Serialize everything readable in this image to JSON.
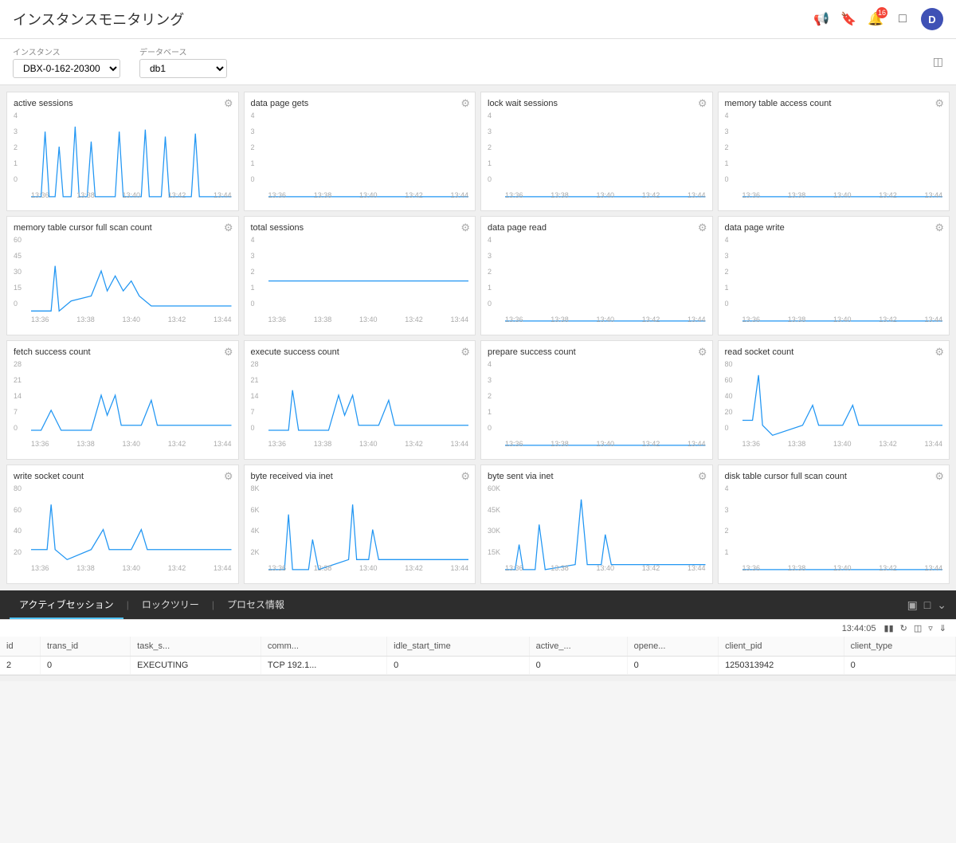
{
  "header": {
    "title": "インスタンスモニタリング",
    "icons": [
      "megaphone",
      "tag",
      "bell",
      "grid",
      "user"
    ],
    "bell_badge": "16",
    "user_initial": "D"
  },
  "toolbar": {
    "instance_label": "インスタンス",
    "instance_value": "DBX-0-162-20300",
    "database_label": "データベース",
    "database_value": "db1"
  },
  "charts": [
    {
      "id": "active-sessions",
      "title": "active sessions",
      "y_labels": [
        "4",
        "3",
        "2",
        "1",
        "0"
      ],
      "x_labels": [
        "13:36",
        "13:38",
        "13:40",
        "13:42",
        "13:44"
      ],
      "has_spikes": true,
      "spike_type": "active"
    },
    {
      "id": "data-page-gets",
      "title": "data page gets",
      "y_labels": [
        "4",
        "3",
        "2",
        "1",
        "0"
      ],
      "x_labels": [
        "13:36",
        "13:38",
        "13:40",
        "13:42",
        "13:44"
      ],
      "has_spikes": false,
      "spike_type": "flat"
    },
    {
      "id": "lock-wait-sessions",
      "title": "lock wait sessions",
      "y_labels": [
        "4",
        "3",
        "2",
        "1",
        "0"
      ],
      "x_labels": [
        "13:36",
        "13:38",
        "13:40",
        "13:42",
        "13:44"
      ],
      "has_spikes": false,
      "spike_type": "flat"
    },
    {
      "id": "memory-table-access-count",
      "title": "memory table access count",
      "y_labels": [
        "4",
        "3",
        "2",
        "1",
        "0"
      ],
      "x_labels": [
        "13:36",
        "13:38",
        "13:40",
        "13:42",
        "13:44"
      ],
      "has_spikes": false,
      "spike_type": "flat"
    },
    {
      "id": "memory-table-cursor-full-scan-count",
      "title": "memory table cursor full scan count",
      "y_labels": [
        "60",
        "45",
        "30",
        "15",
        "0"
      ],
      "x_labels": [
        "13:36",
        "13:38",
        "13:40",
        "13:42",
        "13:44"
      ],
      "has_spikes": true,
      "spike_type": "scan"
    },
    {
      "id": "total-sessions",
      "title": "total sessions",
      "y_labels": [
        "4",
        "3",
        "2",
        "1",
        "0"
      ],
      "x_labels": [
        "13:36",
        "13:38",
        "13:40",
        "13:42",
        "13:44"
      ],
      "has_spikes": false,
      "spike_type": "flat2"
    },
    {
      "id": "data-page-read",
      "title": "data page read",
      "y_labels": [
        "4",
        "3",
        "2",
        "1",
        "0"
      ],
      "x_labels": [
        "13:36",
        "13:38",
        "13:40",
        "13:42",
        "13:44"
      ],
      "has_spikes": false,
      "spike_type": "flat"
    },
    {
      "id": "data-page-write",
      "title": "data page write",
      "y_labels": [
        "4",
        "3",
        "2",
        "1",
        "0"
      ],
      "x_labels": [
        "13:36",
        "13:38",
        "13:40",
        "13:42",
        "13:44"
      ],
      "has_spikes": false,
      "spike_type": "flat"
    },
    {
      "id": "fetch-success-count",
      "title": "fetch success count",
      "y_labels": [
        "28",
        "21",
        "14",
        "7",
        "0"
      ],
      "x_labels": [
        "13:36",
        "13:38",
        "13:40",
        "13:42",
        "13:44"
      ],
      "has_spikes": true,
      "spike_type": "fetch"
    },
    {
      "id": "execute-success-count",
      "title": "execute success count",
      "y_labels": [
        "28",
        "21",
        "14",
        "7",
        "0"
      ],
      "x_labels": [
        "13:36",
        "13:38",
        "13:40",
        "13:42",
        "13:44"
      ],
      "has_spikes": true,
      "spike_type": "execute"
    },
    {
      "id": "prepare-success-count",
      "title": "prepare success count",
      "y_labels": [
        "4",
        "3",
        "2",
        "1",
        "0"
      ],
      "x_labels": [
        "13:36",
        "13:38",
        "13:40",
        "13:42",
        "13:44"
      ],
      "has_spikes": false,
      "spike_type": "flat"
    },
    {
      "id": "read-socket-count",
      "title": "read socket count",
      "y_labels": [
        "80",
        "60",
        "40",
        "20",
        "0"
      ],
      "x_labels": [
        "13:36",
        "13:38",
        "13:40",
        "13:42",
        "13:44"
      ],
      "has_spikes": true,
      "spike_type": "socket"
    },
    {
      "id": "write-socket-count",
      "title": "write socket count",
      "y_labels": [
        "80",
        "60",
        "40",
        "20"
      ],
      "x_labels": [
        "13:36",
        "13:38",
        "13:40",
        "13:42",
        "13:44"
      ],
      "has_spikes": true,
      "spike_type": "write"
    },
    {
      "id": "byte-received-via-inet",
      "title": "byte received via inet",
      "y_labels": [
        "8K",
        "6K",
        "4K",
        "2K"
      ],
      "x_labels": [
        "13:36",
        "13:38",
        "13:40",
        "13:42",
        "13:44"
      ],
      "has_spikes": true,
      "spike_type": "byte-recv"
    },
    {
      "id": "byte-sent-via-inet",
      "title": "byte sent via inet",
      "y_labels": [
        "60K",
        "45K",
        "30K",
        "15K"
      ],
      "x_labels": [
        "13:36",
        "13:38",
        "13:40",
        "13:42",
        "13:44"
      ],
      "has_spikes": true,
      "spike_type": "byte-sent"
    },
    {
      "id": "disk-table-cursor-full-scan-count",
      "title": "disk table cursor full scan count",
      "y_labels": [
        "4",
        "3",
        "2",
        "1"
      ],
      "x_labels": [
        "13:36",
        "13:38",
        "13:40",
        "13:42",
        "13:44"
      ],
      "has_spikes": false,
      "spike_type": "flat"
    }
  ],
  "bottom_panel": {
    "tabs": [
      "アクティブセッション",
      "ロックツリー",
      "プロセス情報"
    ],
    "active_tab": 0,
    "timestamp": "13:44:05"
  },
  "table": {
    "columns": [
      "id",
      "trans_id",
      "task_s...",
      "comm...",
      "idle_start_time",
      "active_...",
      "opene...",
      "client_pid",
      "client_type"
    ],
    "rows": [
      [
        "2",
        "0",
        "EXECUTING",
        "TCP 192.1...",
        "0",
        "0",
        "0",
        "1250313942",
        "0"
      ]
    ]
  }
}
